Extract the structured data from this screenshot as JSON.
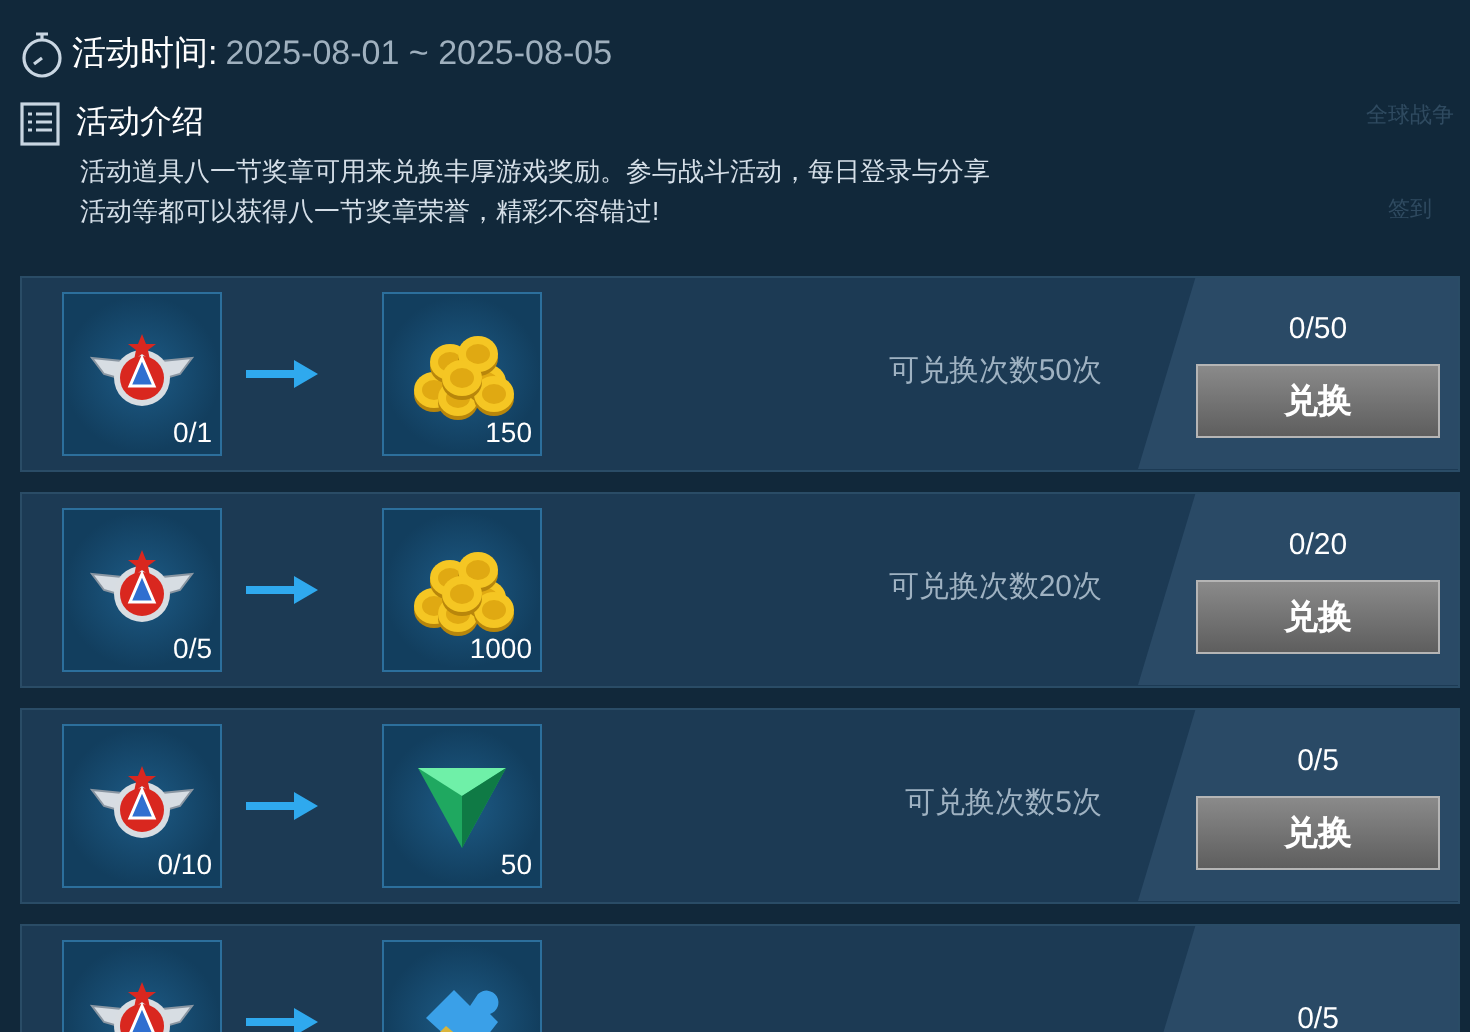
{
  "header": {
    "time_label": "活动时间:",
    "time_value": "2025-08-01 ~ 2025-08-05",
    "intro_title": "活动介绍",
    "intro_lines": [
      "活动道具八一节奖章可用来兑换丰厚游戏奖励。参与战斗活动，每日登录与分享",
      "活动等都可以获得八一节奖章荣誉，精彩不容错过!"
    ]
  },
  "side_menu": [
    {
      "label": "全球战争"
    },
    {
      "label": "签到"
    }
  ],
  "exchanges": [
    {
      "cost": {
        "kind": "medal",
        "count": "0/1"
      },
      "reward": {
        "kind": "coins",
        "count": "150"
      },
      "limit": "可兑换次数50次",
      "times_exchanged": "0/50",
      "button": "兑换"
    },
    {
      "cost": {
        "kind": "medal",
        "count": "0/5"
      },
      "reward": {
        "kind": "coins",
        "count": "1000"
      },
      "limit": "可兑换次数20次",
      "times_exchanged": "0/20",
      "button": "兑换"
    },
    {
      "cost": {
        "kind": "medal",
        "count": "0/10"
      },
      "reward": {
        "kind": "gem",
        "count": "50"
      },
      "limit": "可兑换次数5次",
      "times_exchanged": "0/5",
      "button": "兑换"
    },
    {
      "cost": {
        "kind": "medal"
      },
      "reward": {
        "kind": "puzzle"
      },
      "times_exchanged": "0/5"
    }
  ]
}
